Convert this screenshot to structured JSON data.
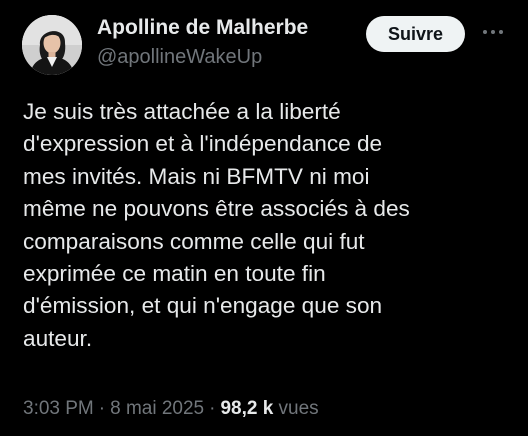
{
  "author": {
    "display_name": "Apolline de Malherbe",
    "handle": "@apollineWakeUp",
    "avatar_icon": "profile-photo"
  },
  "actions": {
    "follow_label": "Suivre",
    "more_icon": "more-dots-icon"
  },
  "tweet": {
    "lines": [
      "Je suis très attachée a la liberté",
      "d'expression et à l'indépendance de",
      "mes invités. Mais ni BFMTV ni moi",
      "même ne pouvons être associés à des",
      "comparaisons comme celle qui fut",
      "exprimée ce matin en toute fin",
      "d'émission, et qui n'engage que son",
      "auteur."
    ]
  },
  "meta": {
    "time": "3:03 PM",
    "separator": "·",
    "date": "8 mai 2025",
    "views_count": "98,2 k",
    "views_label": "vues"
  },
  "colors": {
    "background": "#000000",
    "primary_text": "#e7e9ea",
    "secondary_text": "#71767b",
    "button_bg": "#eff3f4",
    "button_text": "#0f1419"
  }
}
